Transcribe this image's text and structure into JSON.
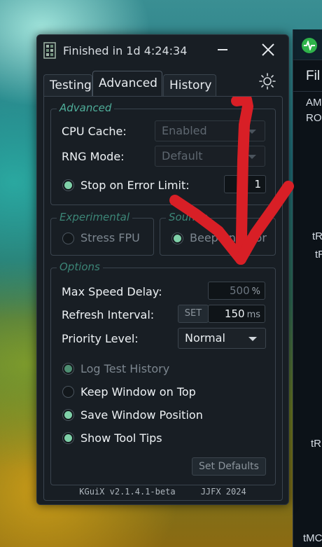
{
  "window": {
    "title": "Finished in 1d 4:24:34"
  },
  "tabs": [
    {
      "label": "Testing"
    },
    {
      "label": "Advanced"
    },
    {
      "label": "History"
    }
  ],
  "advanced": {
    "legend": "Advanced",
    "cpu_cache": {
      "label": "CPU Cache:",
      "value": "Enabled"
    },
    "rng_mode": {
      "label": "RNG Mode:",
      "value": "Default"
    },
    "stop_on_error": {
      "label": "Stop on Error Limit:",
      "value": "1",
      "checked": true
    }
  },
  "experimental": {
    "legend": "Experimental",
    "stress_fpu": {
      "label": "Stress FPU",
      "checked": false
    }
  },
  "sounds": {
    "legend": "Sounds",
    "beep_on_error": {
      "label": "Beep on Error",
      "checked": true
    }
  },
  "options": {
    "legend": "Options",
    "max_speed_delay": {
      "label": "Max Speed Delay:",
      "value": "500",
      "unit": "%"
    },
    "refresh_interval": {
      "label": "Refresh Interval:",
      "set_label": "SET",
      "value": "150",
      "unit": "ms"
    },
    "priority_level": {
      "label": "Priority Level:",
      "value": "Normal"
    },
    "log_test_history": {
      "label": "Log Test History",
      "checked": true
    },
    "keep_window_on_top": {
      "label": "Keep Window on Top",
      "checked": false
    },
    "save_window_position": {
      "label": "Save Window Position",
      "checked": true
    },
    "show_tool_tips": {
      "label": "Show Tool Tips",
      "checked": true
    },
    "set_defaults_label": "Set Defaults"
  },
  "footer": {
    "version": "KGuiX v2.1.4.1-beta",
    "credit": "JJFX 2024"
  },
  "background_app": {
    "menu": "Fil",
    "line1": "AM",
    "line2": "ROC",
    "labels": [
      "tR",
      "tR",
      "tR",
      "tMC"
    ]
  },
  "colors": {
    "accent_green": "#7fd0a8",
    "legend_teal": "#4fae9a",
    "annotation_red": "#d81f26"
  }
}
